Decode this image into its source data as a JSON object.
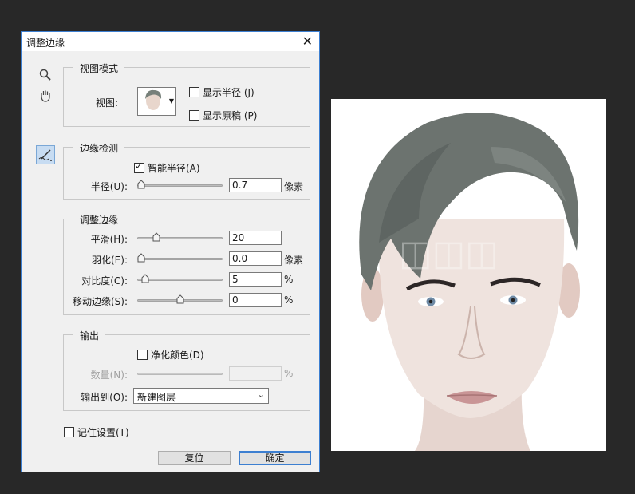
{
  "dialog": {
    "title": "调整边缘",
    "close_symbol": "✕",
    "tools": [
      "zoom-tool",
      "hand-tool",
      "refine-radius-tool"
    ],
    "view_mode": {
      "legend": "视图模式",
      "view_label": "视图:",
      "show_radius": "显示半径 (J)",
      "show_original": "显示原稿 (P)"
    },
    "edge_detection": {
      "legend": "边缘检测",
      "smart_radius": "智能半径(A)",
      "smart_radius_checked": true,
      "radius_label": "半径(U):",
      "radius_value": "0.7",
      "radius_unit": "像素",
      "radius_slider": 0.0
    },
    "adjust_edge": {
      "legend": "调整边缘",
      "smooth_label": "平滑(H):",
      "smooth_value": "20",
      "smooth_slider": 0.2,
      "feather_label": "羽化(E):",
      "feather_value": "0.0",
      "feather_unit": "像素",
      "feather_slider": 0.0,
      "contrast_label": "对比度(C):",
      "contrast_value": "5",
      "contrast_unit": "%",
      "contrast_slider": 0.05,
      "shift_label": "移动边缘(S):",
      "shift_value": "0",
      "shift_unit": "%",
      "shift_slider": 0.5
    },
    "output": {
      "legend": "输出",
      "decontaminate": "净化颜色(D)",
      "amount_label": "数量(N):",
      "amount_unit": "%",
      "output_to_label": "输出到(O):",
      "output_to_value": "新建图层"
    },
    "remember": "记住设置(T)",
    "reset_button": "复位",
    "ok_button": "确定"
  },
  "colors": {
    "background": "#282828",
    "dialog_bg": "#f0f0f0",
    "accent": "#3c7fd1"
  }
}
